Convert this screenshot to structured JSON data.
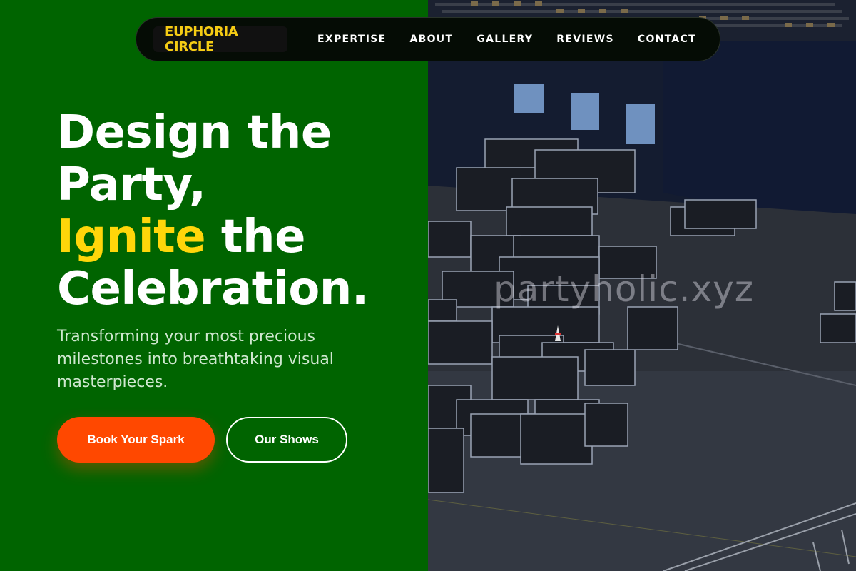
{
  "nav": {
    "brand": "EUPHORIA CIRCLE",
    "links": [
      "EXPERTISE",
      "ABOUT",
      "GALLERY",
      "REVIEWS",
      "CONTACT"
    ]
  },
  "hero": {
    "title_line1": "Design the",
    "title_line2": "Party,",
    "title_accent": "Ignite",
    "title_line3_rest": " the",
    "title_line4": "Celebration.",
    "subtitle": "Transforming your most precious milestones into breathtaking visual masterpieces.",
    "primary_cta": "Book Your Spark",
    "secondary_cta": "Our Shows"
  },
  "image": {
    "watermark": "partyholic.xyz",
    "description_icon": "arena-stage-equipment-cases-photo"
  },
  "colors": {
    "background_green": "#006400",
    "accent_yellow": "#ffd60a",
    "brand_yellow": "#f5cc14",
    "cta_orange": "#ff4800",
    "nav_bg": "#050c05"
  }
}
